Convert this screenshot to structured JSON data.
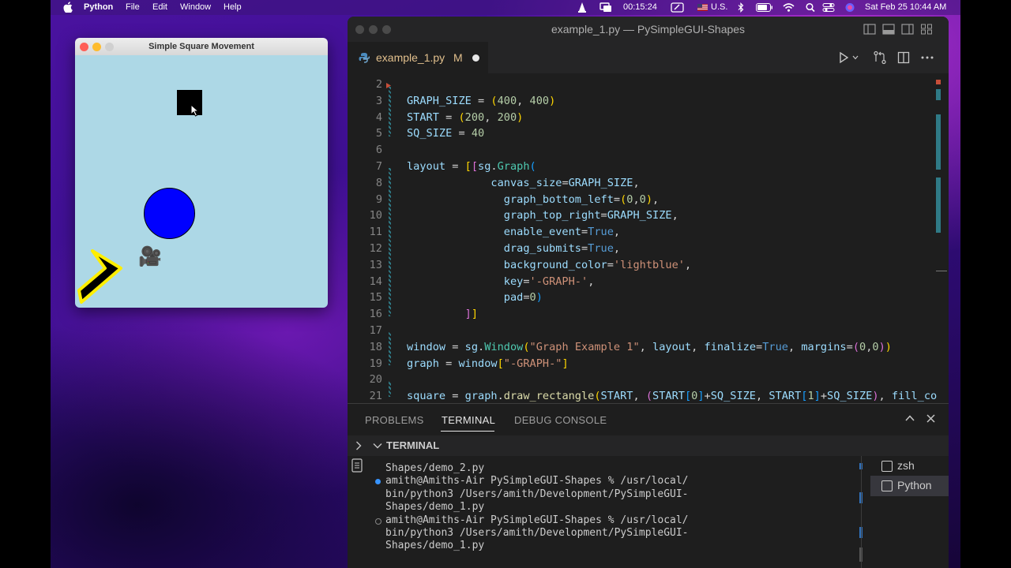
{
  "menubar": {
    "app": "Python",
    "items": [
      "File",
      "Edit",
      "Window",
      "Help"
    ],
    "timer": "00:15:24",
    "input_source": "U.S.",
    "datetime": "Sat Feb 25  10:44 AM"
  },
  "pywindow": {
    "title": "Simple Square Movement",
    "canvas_bg": "#add8e6",
    "camera_emoji": "🎥"
  },
  "vscode": {
    "window_title": "example_1.py — PySimpleGUI-Shapes",
    "tab": {
      "name": "example_1.py",
      "status": "M"
    },
    "code": [
      {
        "n": "2",
        "t": [
          [
            "",
            ""
          ]
        ]
      },
      {
        "n": "3",
        "t": [
          [
            "c-var",
            "GRAPH_SIZE"
          ],
          [
            "",
            " = "
          ],
          [
            "c-br1",
            "("
          ],
          [
            "c-num",
            "400"
          ],
          [
            "",
            ", "
          ],
          [
            "c-num",
            "400"
          ],
          [
            "c-br1",
            ")"
          ]
        ]
      },
      {
        "n": "4",
        "t": [
          [
            "c-var",
            "START"
          ],
          [
            "",
            " = "
          ],
          [
            "c-br1",
            "("
          ],
          [
            "c-num",
            "200"
          ],
          [
            "",
            ", "
          ],
          [
            "c-num",
            "200"
          ],
          [
            "c-br1",
            ")"
          ]
        ]
      },
      {
        "n": "5",
        "t": [
          [
            "c-var",
            "SQ_SIZE"
          ],
          [
            "",
            " = "
          ],
          [
            "c-num",
            "40"
          ]
        ]
      },
      {
        "n": "6",
        "t": [
          [
            "",
            ""
          ]
        ]
      },
      {
        "n": "7",
        "t": [
          [
            "c-var",
            "layout"
          ],
          [
            "",
            " = "
          ],
          [
            "c-br1",
            "["
          ],
          [
            "c-br2",
            "["
          ],
          [
            "c-var",
            "sg"
          ],
          [
            "",
            "."
          ],
          [
            "c-cls",
            "Graph"
          ],
          [
            "c-br3",
            "("
          ]
        ]
      },
      {
        "n": "8",
        "t": [
          [
            "",
            "             "
          ],
          [
            "c-var",
            "canvas_size"
          ],
          [
            "",
            "="
          ],
          [
            "c-var",
            "GRAPH_SIZE"
          ],
          [
            "",
            ","
          ]
        ]
      },
      {
        "n": "9",
        "t": [
          [
            "",
            "               "
          ],
          [
            "c-var",
            "graph_bottom_left"
          ],
          [
            "",
            "="
          ],
          [
            "c-br1",
            "("
          ],
          [
            "c-num",
            "0"
          ],
          [
            "",
            ","
          ],
          [
            "c-num",
            "0"
          ],
          [
            "c-br1",
            ")"
          ],
          [
            "",
            ","
          ]
        ]
      },
      {
        "n": "10",
        "t": [
          [
            "",
            "               "
          ],
          [
            "c-var",
            "graph_top_right"
          ],
          [
            "",
            "="
          ],
          [
            "c-var",
            "GRAPH_SIZE"
          ],
          [
            "",
            ","
          ]
        ]
      },
      {
        "n": "11",
        "t": [
          [
            "",
            "               "
          ],
          [
            "c-var",
            "enable_event"
          ],
          [
            "",
            "="
          ],
          [
            "c-kw",
            "True"
          ],
          [
            "",
            ","
          ]
        ]
      },
      {
        "n": "12",
        "t": [
          [
            "",
            "               "
          ],
          [
            "c-var",
            "drag_submits"
          ],
          [
            "",
            "="
          ],
          [
            "c-kw",
            "True"
          ],
          [
            "",
            ","
          ]
        ]
      },
      {
        "n": "13",
        "t": [
          [
            "",
            "               "
          ],
          [
            "c-var",
            "background_color"
          ],
          [
            "",
            "="
          ],
          [
            "c-str",
            "'lightblue'"
          ],
          [
            "",
            ","
          ]
        ]
      },
      {
        "n": "14",
        "t": [
          [
            "",
            "               "
          ],
          [
            "c-var",
            "key"
          ],
          [
            "",
            "="
          ],
          [
            "c-str",
            "'-GRAPH-'"
          ],
          [
            "",
            ","
          ]
        ]
      },
      {
        "n": "15",
        "t": [
          [
            "",
            "               "
          ],
          [
            "c-var",
            "pad"
          ],
          [
            "",
            "="
          ],
          [
            "c-num",
            "0"
          ],
          [
            "c-br3",
            ")"
          ]
        ]
      },
      {
        "n": "16",
        "t": [
          [
            "",
            "         "
          ],
          [
            "c-br2",
            "]"
          ],
          [
            "c-br1",
            "]"
          ]
        ]
      },
      {
        "n": "17",
        "t": [
          [
            "",
            ""
          ]
        ]
      },
      {
        "n": "18",
        "t": [
          [
            "c-var",
            "window"
          ],
          [
            "",
            " = "
          ],
          [
            "c-var",
            "sg"
          ],
          [
            "",
            "."
          ],
          [
            "c-cls",
            "Window"
          ],
          [
            "c-br1",
            "("
          ],
          [
            "c-str",
            "\"Graph Example 1\""
          ],
          [
            "",
            ", "
          ],
          [
            "c-var",
            "layout"
          ],
          [
            "",
            ", "
          ],
          [
            "c-var",
            "finalize"
          ],
          [
            "",
            "="
          ],
          [
            "c-kw",
            "True"
          ],
          [
            "",
            ", "
          ],
          [
            "c-var",
            "margins"
          ],
          [
            "",
            "="
          ],
          [
            "c-br2",
            "("
          ],
          [
            "c-num",
            "0"
          ],
          [
            "",
            ","
          ],
          [
            "c-num",
            "0"
          ],
          [
            "c-br2",
            ")"
          ],
          [
            "c-br1",
            ")"
          ]
        ]
      },
      {
        "n": "19",
        "t": [
          [
            "c-var",
            "graph"
          ],
          [
            "",
            " = "
          ],
          [
            "c-var",
            "window"
          ],
          [
            "c-br1",
            "["
          ],
          [
            "c-str",
            "\"-GRAPH-\""
          ],
          [
            "c-br1",
            "]"
          ]
        ]
      },
      {
        "n": "20",
        "t": [
          [
            "",
            ""
          ]
        ]
      },
      {
        "n": "21",
        "t": [
          [
            "c-var",
            "square"
          ],
          [
            "",
            " = "
          ],
          [
            "c-var",
            "graph"
          ],
          [
            "",
            "."
          ],
          [
            "c-fn",
            "draw_rectangle"
          ],
          [
            "c-br1",
            "("
          ],
          [
            "c-var",
            "START"
          ],
          [
            "",
            ", "
          ],
          [
            "c-br2",
            "("
          ],
          [
            "c-var",
            "START"
          ],
          [
            "c-br3",
            "["
          ],
          [
            "c-num",
            "0"
          ],
          [
            "c-br3",
            "]"
          ],
          [
            "",
            "+"
          ],
          [
            "c-var",
            "SQ_SIZE"
          ],
          [
            "",
            ", "
          ],
          [
            "c-var",
            "START"
          ],
          [
            "c-br3",
            "["
          ],
          [
            "c-num",
            "1"
          ],
          [
            "c-br3",
            "]"
          ],
          [
            "",
            "+"
          ],
          [
            "c-var",
            "SQ_SIZE"
          ],
          [
            "c-br2",
            ")"
          ],
          [
            "",
            ", "
          ],
          [
            "c-var",
            "fill_co"
          ]
        ]
      }
    ],
    "panel_tabs": [
      "PROBLEMS",
      "TERMINAL",
      "DEBUG CONSOLE"
    ],
    "terminal_header": "TERMINAL",
    "terminal_lines": [
      "Shapes/demo_2.py",
      "amith@Amiths-Air PySimpleGUI-Shapes % /usr/local/",
      "bin/python3 /Users/amith/Development/PySimpleGUI-",
      "Shapes/demo_1.py",
      "amith@Amiths-Air PySimpleGUI-Shapes % /usr/local/",
      "bin/python3 /Users/amith/Development/PySimpleGUI-",
      "Shapes/demo_1.py"
    ],
    "sessions": [
      "zsh",
      "Python"
    ]
  }
}
